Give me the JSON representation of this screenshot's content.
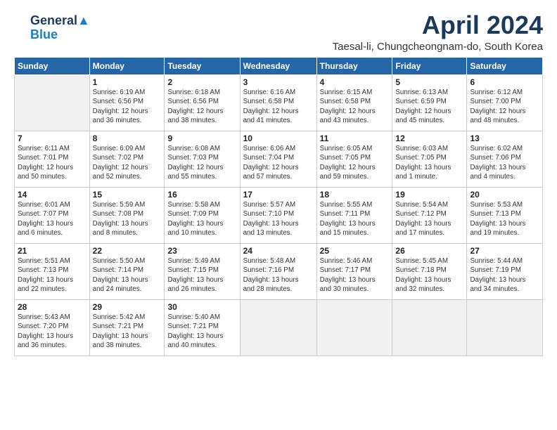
{
  "logo": {
    "line1": "General",
    "line2": "Blue"
  },
  "title": "April 2024",
  "location": "Taesal-li, Chungcheongnam-do, South Korea",
  "days_of_week": [
    "Sunday",
    "Monday",
    "Tuesday",
    "Wednesday",
    "Thursday",
    "Friday",
    "Saturday"
  ],
  "weeks": [
    [
      {
        "day": "",
        "empty": true
      },
      {
        "day": "1",
        "info": "Sunrise: 6:19 AM\nSunset: 6:56 PM\nDaylight: 12 hours\nand 36 minutes."
      },
      {
        "day": "2",
        "info": "Sunrise: 6:18 AM\nSunset: 6:56 PM\nDaylight: 12 hours\nand 38 minutes."
      },
      {
        "day": "3",
        "info": "Sunrise: 6:16 AM\nSunset: 6:58 PM\nDaylight: 12 hours\nand 41 minutes."
      },
      {
        "day": "4",
        "info": "Sunrise: 6:15 AM\nSunset: 6:58 PM\nDaylight: 12 hours\nand 43 minutes."
      },
      {
        "day": "5",
        "info": "Sunrise: 6:13 AM\nSunset: 6:59 PM\nDaylight: 12 hours\nand 45 minutes."
      },
      {
        "day": "6",
        "info": "Sunrise: 6:12 AM\nSunset: 7:00 PM\nDaylight: 12 hours\nand 48 minutes."
      }
    ],
    [
      {
        "day": "7",
        "info": "Sunrise: 6:11 AM\nSunset: 7:01 PM\nDaylight: 12 hours\nand 50 minutes."
      },
      {
        "day": "8",
        "info": "Sunrise: 6:09 AM\nSunset: 7:02 PM\nDaylight: 12 hours\nand 52 minutes."
      },
      {
        "day": "9",
        "info": "Sunrise: 6:08 AM\nSunset: 7:03 PM\nDaylight: 12 hours\nand 55 minutes."
      },
      {
        "day": "10",
        "info": "Sunrise: 6:06 AM\nSunset: 7:04 PM\nDaylight: 12 hours\nand 57 minutes."
      },
      {
        "day": "11",
        "info": "Sunrise: 6:05 AM\nSunset: 7:05 PM\nDaylight: 12 hours\nand 59 minutes."
      },
      {
        "day": "12",
        "info": "Sunrise: 6:03 AM\nSunset: 7:05 PM\nDaylight: 13 hours\nand 1 minute."
      },
      {
        "day": "13",
        "info": "Sunrise: 6:02 AM\nSunset: 7:06 PM\nDaylight: 13 hours\nand 4 minutes."
      }
    ],
    [
      {
        "day": "14",
        "info": "Sunrise: 6:01 AM\nSunset: 7:07 PM\nDaylight: 13 hours\nand 6 minutes."
      },
      {
        "day": "15",
        "info": "Sunrise: 5:59 AM\nSunset: 7:08 PM\nDaylight: 13 hours\nand 8 minutes."
      },
      {
        "day": "16",
        "info": "Sunrise: 5:58 AM\nSunset: 7:09 PM\nDaylight: 13 hours\nand 10 minutes."
      },
      {
        "day": "17",
        "info": "Sunrise: 5:57 AM\nSunset: 7:10 PM\nDaylight: 13 hours\nand 13 minutes."
      },
      {
        "day": "18",
        "info": "Sunrise: 5:55 AM\nSunset: 7:11 PM\nDaylight: 13 hours\nand 15 minutes."
      },
      {
        "day": "19",
        "info": "Sunrise: 5:54 AM\nSunset: 7:12 PM\nDaylight: 13 hours\nand 17 minutes."
      },
      {
        "day": "20",
        "info": "Sunrise: 5:53 AM\nSunset: 7:13 PM\nDaylight: 13 hours\nand 19 minutes."
      }
    ],
    [
      {
        "day": "21",
        "info": "Sunrise: 5:51 AM\nSunset: 7:13 PM\nDaylight: 13 hours\nand 22 minutes."
      },
      {
        "day": "22",
        "info": "Sunrise: 5:50 AM\nSunset: 7:14 PM\nDaylight: 13 hours\nand 24 minutes."
      },
      {
        "day": "23",
        "info": "Sunrise: 5:49 AM\nSunset: 7:15 PM\nDaylight: 13 hours\nand 26 minutes."
      },
      {
        "day": "24",
        "info": "Sunrise: 5:48 AM\nSunset: 7:16 PM\nDaylight: 13 hours\nand 28 minutes."
      },
      {
        "day": "25",
        "info": "Sunrise: 5:46 AM\nSunset: 7:17 PM\nDaylight: 13 hours\nand 30 minutes."
      },
      {
        "day": "26",
        "info": "Sunrise: 5:45 AM\nSunset: 7:18 PM\nDaylight: 13 hours\nand 32 minutes."
      },
      {
        "day": "27",
        "info": "Sunrise: 5:44 AM\nSunset: 7:19 PM\nDaylight: 13 hours\nand 34 minutes."
      }
    ],
    [
      {
        "day": "28",
        "info": "Sunrise: 5:43 AM\nSunset: 7:20 PM\nDaylight: 13 hours\nand 36 minutes."
      },
      {
        "day": "29",
        "info": "Sunrise: 5:42 AM\nSunset: 7:21 PM\nDaylight: 13 hours\nand 38 minutes."
      },
      {
        "day": "30",
        "info": "Sunrise: 5:40 AM\nSunset: 7:21 PM\nDaylight: 13 hours\nand 40 minutes."
      },
      {
        "day": "",
        "empty": true
      },
      {
        "day": "",
        "empty": true
      },
      {
        "day": "",
        "empty": true
      },
      {
        "day": "",
        "empty": true
      }
    ]
  ]
}
